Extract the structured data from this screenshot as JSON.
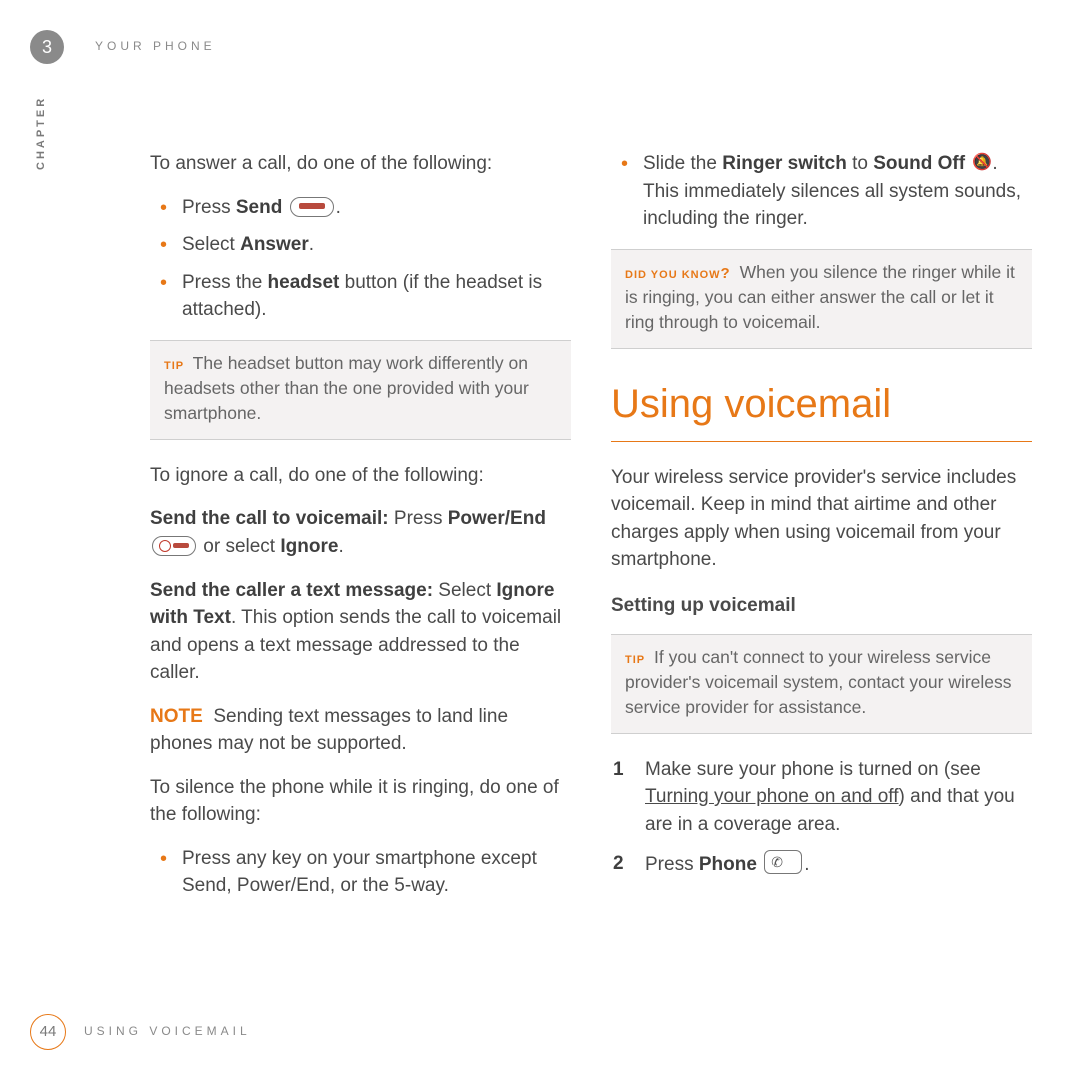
{
  "header": {
    "running": "YOUR PHONE",
    "chapter_label": "CHAPTER",
    "chapter_num": "3"
  },
  "footer": {
    "page_num": "44",
    "running": "USING VOICEMAIL"
  },
  "left": {
    "answer_intro": "To answer a call, do one of the following:",
    "bullets1": {
      "b1a": "Press ",
      "b1b": "Send",
      "b1c": ".",
      "b2a": "Select ",
      "b2b": "Answer",
      "b2c": ".",
      "b3a": "Press the ",
      "b3b": "headset",
      "b3c": " button (if the headset is attached)."
    },
    "tip1_label": "TIP",
    "tip1": "The headset button may work differently on headsets other than the one provided with your smartphone.",
    "ignore_intro": "To ignore a call, do one of the following:",
    "vm1a": "Send the call to voicemail:",
    "vm1b": " Press ",
    "vm1c": "Power/End",
    "vm1d": " or select ",
    "vm1e": "Ignore",
    "vm1f": ".",
    "txt1a": "Send the caller a text message:",
    "txt1b": " Select ",
    "txt1c": "Ignore with Text",
    "txt1d": ". This option sends the call to voicemail and opens a text message addressed to the caller.",
    "note_label": "NOTE",
    "note_text": "Sending text messages to land line phones may not be supported.",
    "silence_intro": "To silence the phone while it is ringing, do one of the following:",
    "bullets2": {
      "b1": "Press any key on your smartphone except Send, Power/End, or the 5-way."
    }
  },
  "right": {
    "bullets3": {
      "b1a": "Slide the ",
      "b1b": "Ringer switch",
      "b1c": " to ",
      "b1d": "Sound Off",
      "b1e": ". This immediately silences all system sounds, including the ringer."
    },
    "dyk_label": "DID YOU KNOW",
    "dyk": "When you silence the ringer while it is ringing, you can either answer the call or let it ring through to voicemail.",
    "section_heading": "Using voicemail",
    "intro": "Your wireless service provider's service includes voicemail. Keep in mind that airtime and other charges apply when using voicemail from your smartphone.",
    "sub_heading": "Setting up voicemail",
    "tip2_label": "TIP",
    "tip2": "If you can't connect to your wireless service provider's voicemail system, contact your wireless service provider for assistance.",
    "steps": {
      "s1a": "Make sure your phone is turned on (see ",
      "s1_link": "Turning your phone on and off",
      "s1b": ") and that you are in a coverage area.",
      "s2a": "Press ",
      "s2b": "Phone",
      "s2c": "."
    }
  }
}
